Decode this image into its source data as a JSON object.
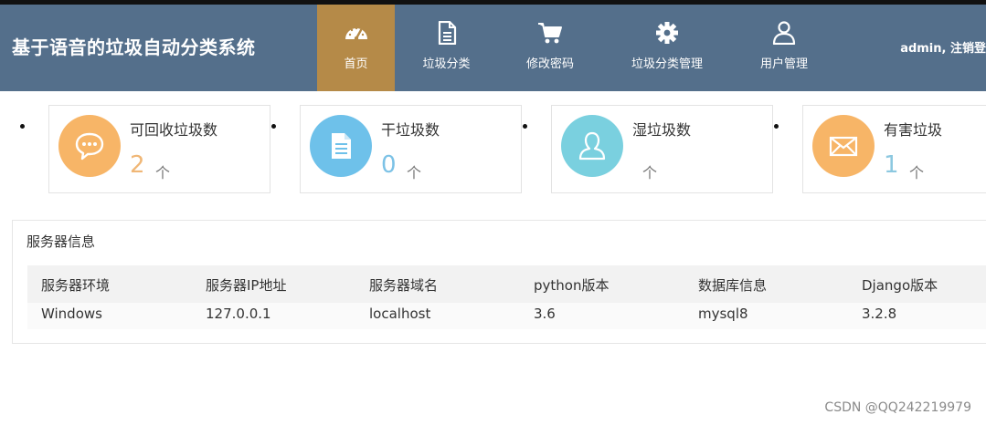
{
  "header": {
    "title": "基于语音的垃圾自动分类系统",
    "user_info": "admin, 注销登",
    "nav": [
      {
        "label": "首页",
        "icon": "dashboard-icon",
        "active": true
      },
      {
        "label": "垃圾分类",
        "icon": "document-icon",
        "active": false
      },
      {
        "label": "修改密码",
        "icon": "cart-icon",
        "active": false
      },
      {
        "label": "垃圾分类管理",
        "icon": "gear-icon",
        "active": false
      },
      {
        "label": "用户管理",
        "icon": "user-icon",
        "active": false
      }
    ],
    "colors": {
      "bar": "#546f8b",
      "active": "#b58a48"
    }
  },
  "stats": [
    {
      "label": "可回收垃圾数",
      "value": "2",
      "unit": "个",
      "icon": "chat-bubble-icon",
      "color": "#f7b567",
      "value_color": "#f0b776"
    },
    {
      "label": "干垃圾数",
      "value": "0",
      "unit": "个",
      "icon": "document-icon",
      "color": "#6ec1ea",
      "value_color": "#7cc2e6"
    },
    {
      "label": "湿垃圾数",
      "value": "",
      "unit": "个",
      "icon": "person-icon",
      "color": "#7ad0df",
      "value_color": "#7fd0de"
    },
    {
      "label": "有害垃圾",
      "value": "1",
      "unit": "个",
      "icon": "envelope-icon",
      "color": "#f7b567",
      "value_color": "#8cc8e0"
    }
  ],
  "server_panel": {
    "title": "服务器信息",
    "headers": [
      "服务器环境",
      "服务器IP地址",
      "服务器域名",
      "python版本",
      "数据库信息",
      "Django版本"
    ],
    "row": [
      "Windows",
      "127.0.0.1",
      "localhost",
      "3.6",
      "mysql8",
      "3.2.8"
    ]
  },
  "watermark": "CSDN @QQ242219979"
}
